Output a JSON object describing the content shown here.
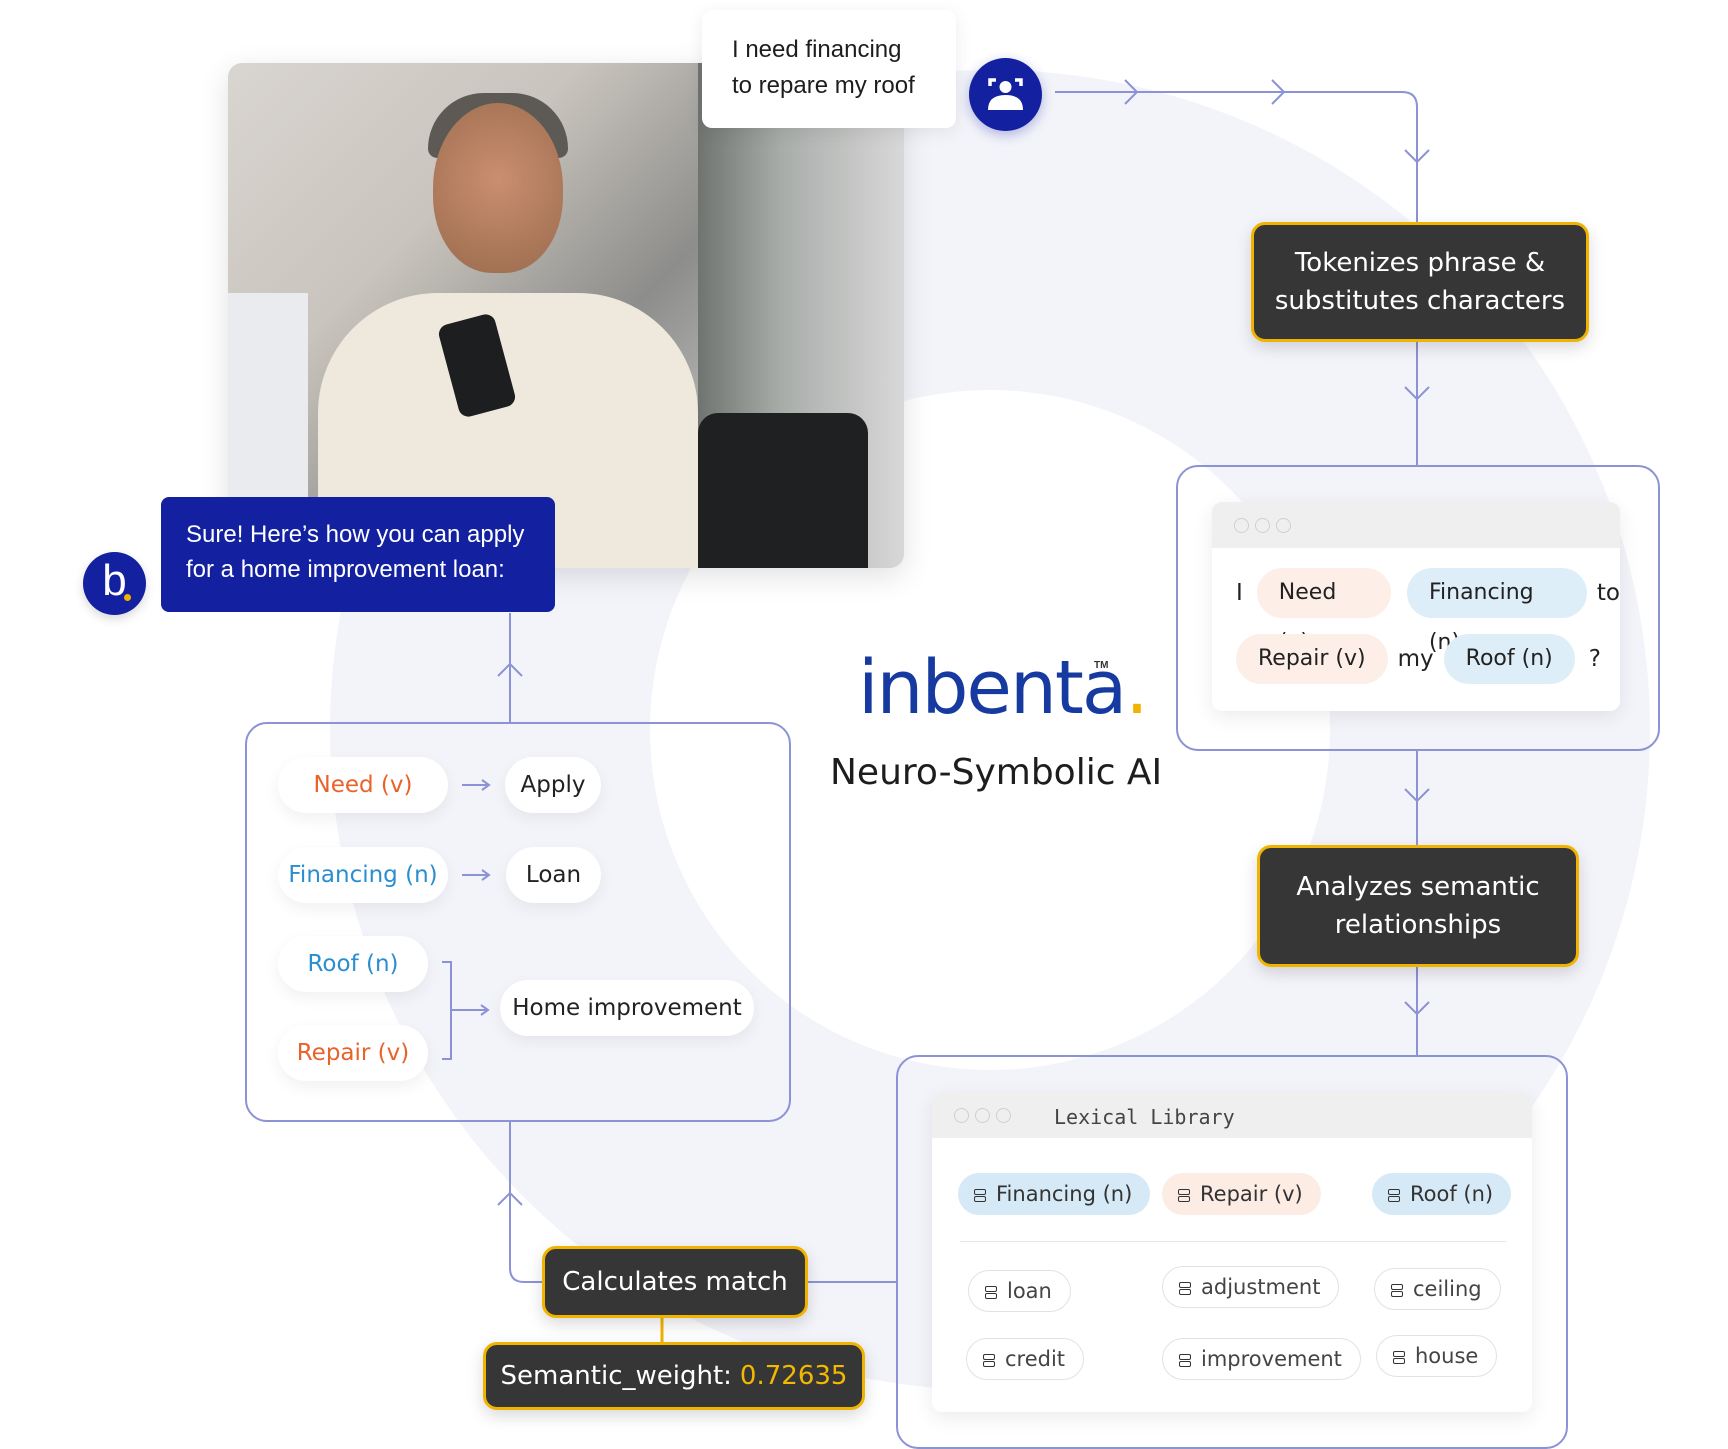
{
  "chat": {
    "user_message_line1": "I need financing",
    "user_message_line2": "to repare my roof",
    "misspelled_word": "repare",
    "bot_message_line1": "Sure! Here’s how you can apply",
    "bot_message_line2": "for a home improvement loan:",
    "bot_avatar_letter": "b"
  },
  "brand": {
    "logo_text": "inbenta",
    "logo_dot": ".",
    "trademark": "TM",
    "subtitle": "Neuro-Symbolic AI",
    "colors": {
      "primary": "#1321a0",
      "accent": "#f2b300",
      "connector": "#8c92d6",
      "dark_box": "#363636"
    }
  },
  "steps": {
    "tokenize": {
      "line1": "Tokenizes phrase &",
      "line2": "substitutes characters"
    },
    "analyze": {
      "line1": "Analyzes semantic",
      "line2": "relationships"
    },
    "calculate": {
      "label": "Calculates match"
    },
    "weight": {
      "label": "Semantic_weight:",
      "value": "0.72635"
    }
  },
  "tokens": {
    "row1": [
      {
        "text": "I",
        "type": "plain"
      },
      {
        "text": "Need (v)",
        "type": "verb"
      },
      {
        "text": "Financing (n)",
        "type": "noun"
      },
      {
        "text": "to",
        "type": "plain"
      }
    ],
    "row2": [
      {
        "text": "Repair (v)",
        "type": "verb"
      },
      {
        "text": "my",
        "type": "plain"
      },
      {
        "text": "Roof (n)",
        "type": "noun"
      },
      {
        "text": "?",
        "type": "plain"
      }
    ]
  },
  "mapping": {
    "need": "Need (v)",
    "apply": "Apply",
    "financing": "Financing (n)",
    "loan": "Loan",
    "roof": "Roof (n)",
    "repair": "Repair (v)",
    "home_improvement": "Home improvement"
  },
  "lexical_library": {
    "title": "Lexical Library",
    "headers": [
      {
        "text": "Financing (n)",
        "type": "noun"
      },
      {
        "text": "Repair (v)",
        "type": "verb"
      },
      {
        "text": "Roof (n)",
        "type": "noun"
      }
    ],
    "synonyms": [
      [
        "loan",
        "adjustment",
        "ceiling"
      ],
      [
        "credit",
        "improvement",
        "house"
      ]
    ]
  }
}
